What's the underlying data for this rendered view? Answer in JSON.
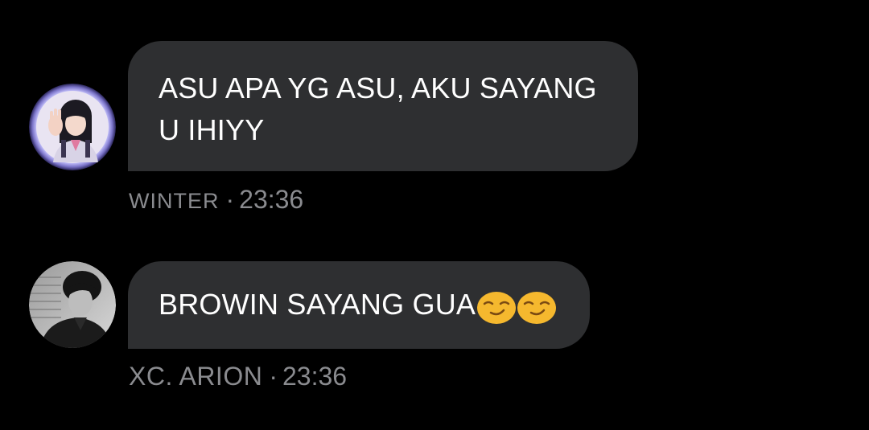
{
  "messages": [
    {
      "sender": "WINTER",
      "time": "23:36",
      "separator": "·",
      "text_line1": "ASU APA YG ASU, AKU SAYANG",
      "text_line2": "U IHIYY",
      "avatar": "girl-photo-avatar"
    },
    {
      "sender": "XC. ARION",
      "time": "23:36",
      "separator": "·",
      "text": "BROWIN SAYANG GUA",
      "emojis": [
        "smirk-face-icon",
        "smirk-face-icon"
      ],
      "avatar": "boy-photo-avatar"
    }
  ],
  "colors": {
    "background": "#000000",
    "bubble": "#2e2f31",
    "meta_text": "#8a8b8f",
    "emoji": "#f5b82e"
  }
}
